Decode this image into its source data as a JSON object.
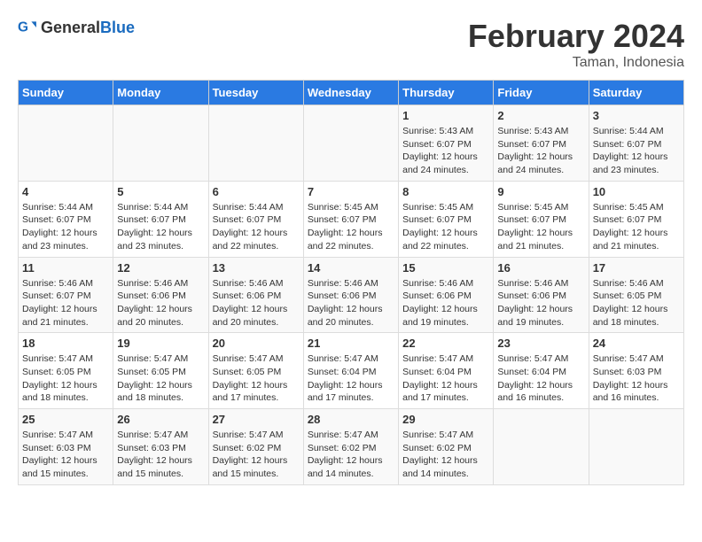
{
  "header": {
    "logo_general": "General",
    "logo_blue": "Blue",
    "month_title": "February 2024",
    "subtitle": "Taman, Indonesia"
  },
  "columns": [
    "Sunday",
    "Monday",
    "Tuesday",
    "Wednesday",
    "Thursday",
    "Friday",
    "Saturday"
  ],
  "weeks": [
    [
      {
        "day": "",
        "info": ""
      },
      {
        "day": "",
        "info": ""
      },
      {
        "day": "",
        "info": ""
      },
      {
        "day": "",
        "info": ""
      },
      {
        "day": "1",
        "info": "Sunrise: 5:43 AM\nSunset: 6:07 PM\nDaylight: 12 hours\nand 24 minutes."
      },
      {
        "day": "2",
        "info": "Sunrise: 5:43 AM\nSunset: 6:07 PM\nDaylight: 12 hours\nand 24 minutes."
      },
      {
        "day": "3",
        "info": "Sunrise: 5:44 AM\nSunset: 6:07 PM\nDaylight: 12 hours\nand 23 minutes."
      }
    ],
    [
      {
        "day": "4",
        "info": "Sunrise: 5:44 AM\nSunset: 6:07 PM\nDaylight: 12 hours\nand 23 minutes."
      },
      {
        "day": "5",
        "info": "Sunrise: 5:44 AM\nSunset: 6:07 PM\nDaylight: 12 hours\nand 23 minutes."
      },
      {
        "day": "6",
        "info": "Sunrise: 5:44 AM\nSunset: 6:07 PM\nDaylight: 12 hours\nand 22 minutes."
      },
      {
        "day": "7",
        "info": "Sunrise: 5:45 AM\nSunset: 6:07 PM\nDaylight: 12 hours\nand 22 minutes."
      },
      {
        "day": "8",
        "info": "Sunrise: 5:45 AM\nSunset: 6:07 PM\nDaylight: 12 hours\nand 22 minutes."
      },
      {
        "day": "9",
        "info": "Sunrise: 5:45 AM\nSunset: 6:07 PM\nDaylight: 12 hours\nand 21 minutes."
      },
      {
        "day": "10",
        "info": "Sunrise: 5:45 AM\nSunset: 6:07 PM\nDaylight: 12 hours\nand 21 minutes."
      }
    ],
    [
      {
        "day": "11",
        "info": "Sunrise: 5:46 AM\nSunset: 6:07 PM\nDaylight: 12 hours\nand 21 minutes."
      },
      {
        "day": "12",
        "info": "Sunrise: 5:46 AM\nSunset: 6:06 PM\nDaylight: 12 hours\nand 20 minutes."
      },
      {
        "day": "13",
        "info": "Sunrise: 5:46 AM\nSunset: 6:06 PM\nDaylight: 12 hours\nand 20 minutes."
      },
      {
        "day": "14",
        "info": "Sunrise: 5:46 AM\nSunset: 6:06 PM\nDaylight: 12 hours\nand 20 minutes."
      },
      {
        "day": "15",
        "info": "Sunrise: 5:46 AM\nSunset: 6:06 PM\nDaylight: 12 hours\nand 19 minutes."
      },
      {
        "day": "16",
        "info": "Sunrise: 5:46 AM\nSunset: 6:06 PM\nDaylight: 12 hours\nand 19 minutes."
      },
      {
        "day": "17",
        "info": "Sunrise: 5:46 AM\nSunset: 6:05 PM\nDaylight: 12 hours\nand 18 minutes."
      }
    ],
    [
      {
        "day": "18",
        "info": "Sunrise: 5:47 AM\nSunset: 6:05 PM\nDaylight: 12 hours\nand 18 minutes."
      },
      {
        "day": "19",
        "info": "Sunrise: 5:47 AM\nSunset: 6:05 PM\nDaylight: 12 hours\nand 18 minutes."
      },
      {
        "day": "20",
        "info": "Sunrise: 5:47 AM\nSunset: 6:05 PM\nDaylight: 12 hours\nand 17 minutes."
      },
      {
        "day": "21",
        "info": "Sunrise: 5:47 AM\nSunset: 6:04 PM\nDaylight: 12 hours\nand 17 minutes."
      },
      {
        "day": "22",
        "info": "Sunrise: 5:47 AM\nSunset: 6:04 PM\nDaylight: 12 hours\nand 17 minutes."
      },
      {
        "day": "23",
        "info": "Sunrise: 5:47 AM\nSunset: 6:04 PM\nDaylight: 12 hours\nand 16 minutes."
      },
      {
        "day": "24",
        "info": "Sunrise: 5:47 AM\nSunset: 6:03 PM\nDaylight: 12 hours\nand 16 minutes."
      }
    ],
    [
      {
        "day": "25",
        "info": "Sunrise: 5:47 AM\nSunset: 6:03 PM\nDaylight: 12 hours\nand 15 minutes."
      },
      {
        "day": "26",
        "info": "Sunrise: 5:47 AM\nSunset: 6:03 PM\nDaylight: 12 hours\nand 15 minutes."
      },
      {
        "day": "27",
        "info": "Sunrise: 5:47 AM\nSunset: 6:02 PM\nDaylight: 12 hours\nand 15 minutes."
      },
      {
        "day": "28",
        "info": "Sunrise: 5:47 AM\nSunset: 6:02 PM\nDaylight: 12 hours\nand 14 minutes."
      },
      {
        "day": "29",
        "info": "Sunrise: 5:47 AM\nSunset: 6:02 PM\nDaylight: 12 hours\nand 14 minutes."
      },
      {
        "day": "",
        "info": ""
      },
      {
        "day": "",
        "info": ""
      }
    ]
  ]
}
